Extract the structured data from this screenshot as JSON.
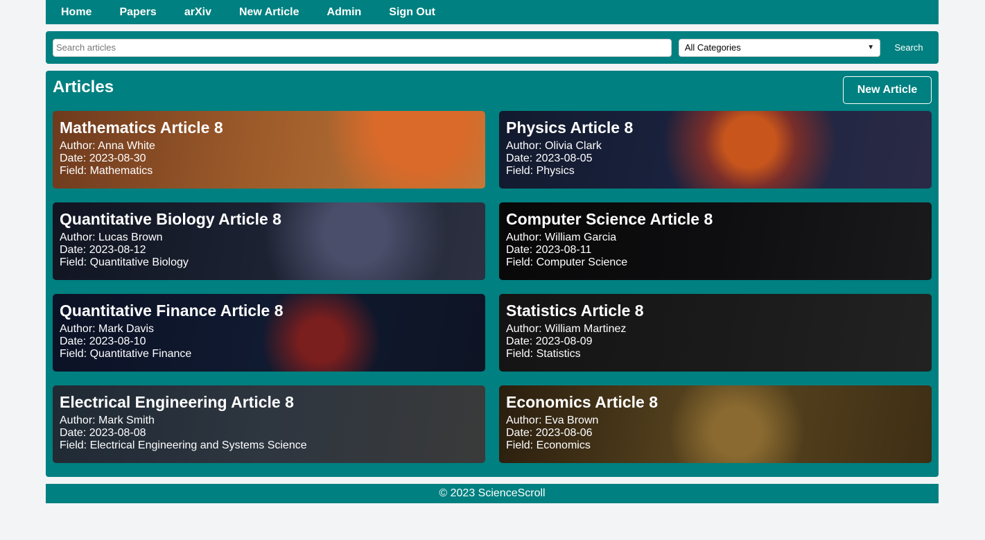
{
  "nav": {
    "items": [
      {
        "label": "Home"
      },
      {
        "label": "Papers"
      },
      {
        "label": "arXiv"
      },
      {
        "label": "New Article"
      },
      {
        "label": "Admin"
      },
      {
        "label": "Sign Out"
      }
    ]
  },
  "search": {
    "placeholder": "Search articles",
    "value": "",
    "category_selected": "All Categories",
    "button_label": "Search"
  },
  "main": {
    "title": "Articles",
    "new_article_label": "New Article",
    "articles": [
      {
        "title": "Mathematics Article 8",
        "author": "Author: Anna White",
        "date": "Date: 2023-08-30",
        "field": "Field: Mathematics"
      },
      {
        "title": "Physics Article 8",
        "author": "Author: Olivia Clark",
        "date": "Date: 2023-08-05",
        "field": "Field: Physics"
      },
      {
        "title": "Quantitative Biology Article 8",
        "author": "Author: Lucas Brown",
        "date": "Date: 2023-08-12",
        "field": "Field: Quantitative Biology"
      },
      {
        "title": "Computer Science Article 8",
        "author": "Author: William Garcia",
        "date": "Date: 2023-08-11",
        "field": "Field: Computer Science"
      },
      {
        "title": "Quantitative Finance Article 8",
        "author": "Author: Mark Davis",
        "date": "Date: 2023-08-10",
        "field": "Field: Quantitative Finance"
      },
      {
        "title": "Statistics Article 8",
        "author": "Author: William Martinez",
        "date": "Date: 2023-08-09",
        "field": "Field: Statistics"
      },
      {
        "title": "Electrical Engineering Article 8",
        "author": "Author: Mark Smith",
        "date": "Date: 2023-08-08",
        "field": "Field: Electrical Engineering and Systems Science"
      },
      {
        "title": "Economics Article 8",
        "author": "Author: Eva Brown",
        "date": "Date: 2023-08-06",
        "field": "Field: Economics"
      }
    ]
  },
  "footer": {
    "text": "© 2023 ScienceScroll"
  },
  "colors": {
    "primary": "#008080",
    "page_background": "#f3f4f6",
    "text_on_primary": "#ffffff"
  }
}
